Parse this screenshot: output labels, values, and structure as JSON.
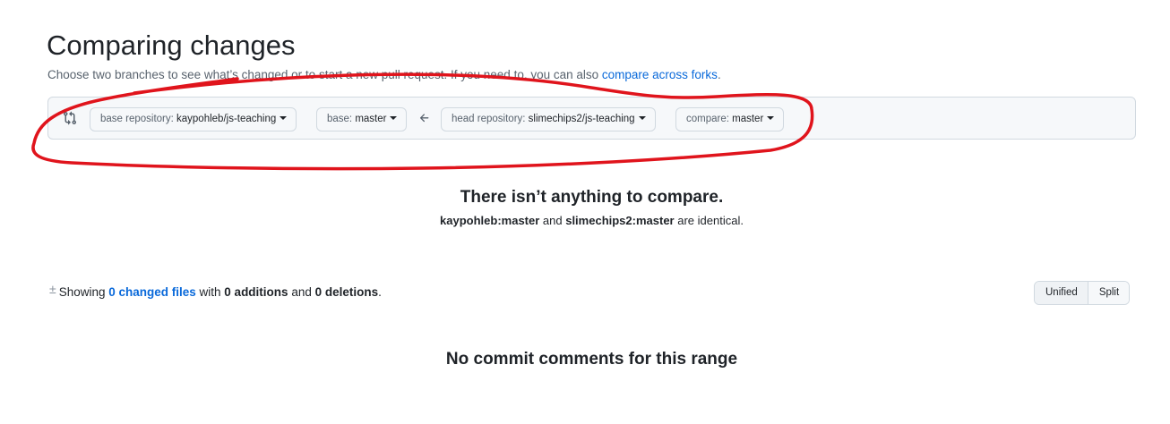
{
  "header": {
    "title": "Comparing changes",
    "subtitle_text": "Choose two branches to see what’s changed or to start a new pull request. If you need to, you can also ",
    "subtitle_link": "compare across forks",
    "subtitle_end": "."
  },
  "range": {
    "compare_icon": "git-compare-icon",
    "base_repo_label": "base repository: ",
    "base_repo_value": "kaypohleb/js-teaching",
    "base_label": "base: ",
    "base_value": "master",
    "arrow_icon": "arrow-left-icon",
    "head_repo_label": "head repository: ",
    "head_repo_value": "slimechips2/js-teaching",
    "compare_label": "compare: ",
    "compare_value": "master"
  },
  "blankslate": {
    "title": "There isn’t anything to compare.",
    "base_ref": "kaypohleb:master",
    "and_text": " and ",
    "head_ref": "slimechips2:master",
    "end_text": " are identical."
  },
  "diff": {
    "icon": "diff-icon",
    "showing": "Showing ",
    "files_link": "0 changed files",
    "with_text": " with ",
    "additions": "0 additions",
    "and_text": " and ",
    "deletions": "0 deletions",
    "end": "."
  },
  "view_toggle": {
    "unified": "Unified",
    "split": "Split",
    "selected": "Unified"
  },
  "comments": {
    "empty_message": "No commit comments for this range"
  },
  "annotation": {
    "color": "#e0141c"
  }
}
